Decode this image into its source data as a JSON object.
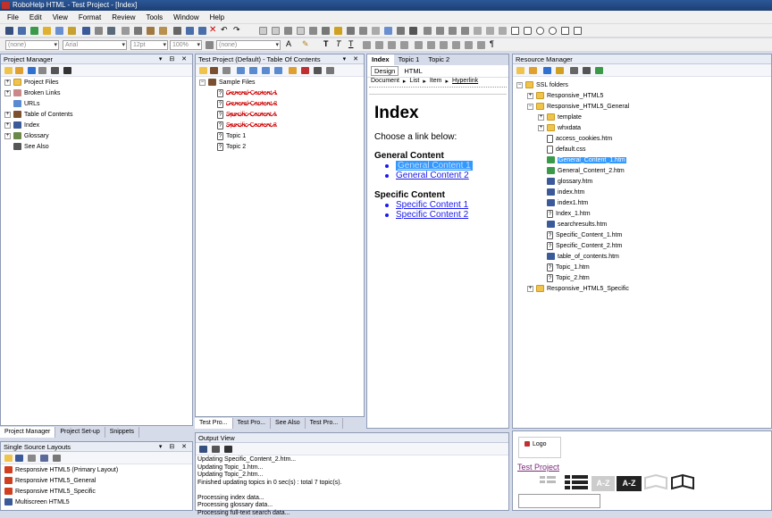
{
  "app": {
    "title": "RoboHelp HTML - Test Project - [Index]"
  },
  "menu": [
    "File",
    "Edit",
    "View",
    "Format",
    "Review",
    "Tools",
    "Window",
    "Help"
  ],
  "format_bar": {
    "style": "(none)",
    "font": "Arial",
    "size": "12pt",
    "zoom": "100%",
    "char_style": "(none)"
  },
  "project_manager": {
    "title": "Project Manager",
    "items": [
      "Project Files",
      "Broken Links",
      "URLs",
      "Table of Contents",
      "Index",
      "Glossary",
      "See Also"
    ],
    "tabs": [
      "Project Manager",
      "Project Set-up",
      "Snippets"
    ]
  },
  "toc": {
    "title": "Test Project (Default) - Table Of Contents",
    "root": "Sample Files",
    "items": [
      "General Content 1",
      "General Content 2",
      "Specific Content 1",
      "Specific Content 2",
      "Topic 1",
      "Topic 2"
    ],
    "tabs": [
      "Test Pro...",
      "Test Pro...",
      "See Also",
      "Test Pro..."
    ]
  },
  "editor": {
    "tabs": [
      "Index",
      "Topic 1",
      "Topic 2"
    ],
    "modes": [
      "Design",
      "HTML"
    ],
    "breadcrumb": [
      "Document",
      "List",
      "Item",
      "Hyperlink"
    ],
    "heading": "Index",
    "intro": "Choose a link below:",
    "sections": [
      {
        "heading": "General Content",
        "links": [
          "General Content 1",
          "General Content 2"
        ]
      },
      {
        "heading": "Specific Content",
        "links": [
          "Specific Content 1",
          "Specific Content 2"
        ]
      }
    ]
  },
  "resource_manager": {
    "title": "Resource Manager",
    "root": "SSL folders",
    "items": [
      "Responsive_HTML5",
      "Responsive_HTML5_General",
      "template",
      "whxdata",
      "access_cookies.htm",
      "default.css",
      "General_Content_1.htm",
      "General_Content_2.htm",
      "glossary.htm",
      "index.htm",
      "index1.htm",
      "Index_1.htm",
      "searchresults.htm",
      "Specific_Content_1.htm",
      "Specific_Content_2.htm",
      "table_of_contents.htm",
      "Topic_1.htm",
      "Topic_2.htm",
      "Responsive_HTML5_Specific"
    ]
  },
  "ssl": {
    "title": "Single Source Layouts",
    "items": [
      "Responsive HTML5 (Primary Layout)",
      "Responsive HTML5_General",
      "Responsive HTML5_Specific",
      "Multiscreen HTML5"
    ]
  },
  "output": {
    "title": "Output View",
    "lines": [
      "Updating Specific_Content_2.htm...",
      "Updating Topic_1.htm...",
      "Updating Topic_2.htm...",
      "Finished updating topics in 0 sec(s) : total 7 topic(s).",
      "",
      "Processing index data...",
      "Processing glossary data...",
      "Processing full-text search data..."
    ]
  },
  "preview": {
    "logo": "Logo",
    "project_link": "Test Project",
    "az1": "A-Z",
    "az2": "A-Z"
  }
}
